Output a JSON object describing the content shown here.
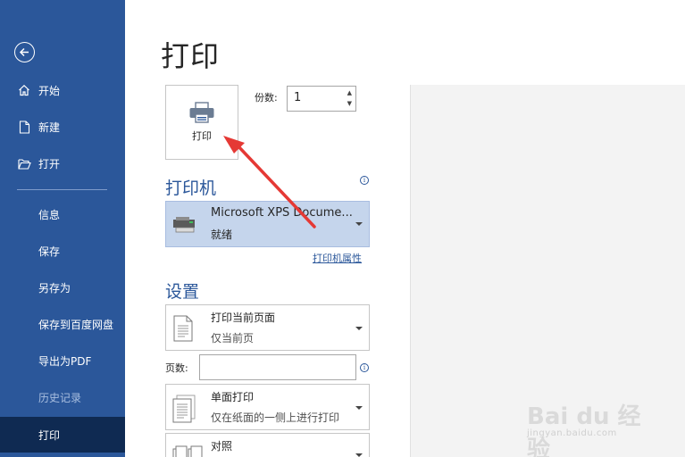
{
  "sidebar": {
    "items": [
      {
        "label": "开始",
        "icon": "home-icon"
      },
      {
        "label": "新建",
        "icon": "new-document-icon"
      },
      {
        "label": "打开",
        "icon": "open-folder-icon"
      },
      {
        "label": "信息"
      },
      {
        "label": "保存"
      },
      {
        "label": "另存为"
      },
      {
        "label": "保存到百度网盘"
      },
      {
        "label": "导出为PDF"
      },
      {
        "label": "历史记录",
        "state": "disabled"
      },
      {
        "label": "打印",
        "state": "active"
      }
    ],
    "accent_color": "#2b579a",
    "active_color": "#0f2a52"
  },
  "main": {
    "title": "打印",
    "print_button_label": "打印",
    "copies_label": "份数:",
    "copies_value": "1",
    "printer": {
      "heading": "打印机",
      "name": "Microsoft XPS Docume...",
      "status": "就绪",
      "properties_link": "打印机属性"
    },
    "settings": {
      "heading": "设置",
      "range": {
        "title": "打印当前页面",
        "subtitle": "仅当前页"
      },
      "pages_label": "页数:",
      "pages_value": "",
      "sides": {
        "title": "单面打印",
        "subtitle": "仅在纸面的一侧上进行打印"
      },
      "collate": {
        "title": "对照",
        "subtitle": ""
      }
    }
  },
  "watermark": {
    "text": "Bai du 经验",
    "url": "jingyan.baidu.com"
  }
}
